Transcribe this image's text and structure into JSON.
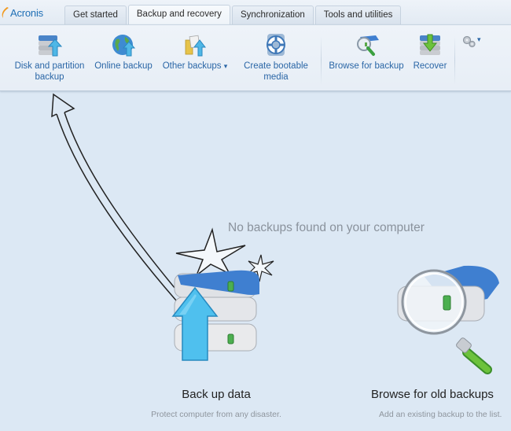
{
  "app": {
    "logo_text": "Acronis",
    "brand_color": "#1f6fb5",
    "link_color": "#2a66a6"
  },
  "tabs": [
    {
      "label": "Get started",
      "active": false
    },
    {
      "label": "Backup and recovery",
      "active": true
    },
    {
      "label": "Synchronization",
      "active": false
    },
    {
      "label": "Tools and utilities",
      "active": false
    }
  ],
  "toolbar": {
    "disk_backup": {
      "line1": "Disk and partition",
      "line2": "backup",
      "icon": "disk-upload-icon"
    },
    "online_backup": {
      "label": "Online backup",
      "icon": "globe-upload-icon"
    },
    "other_backups": {
      "label": "Other backups",
      "dropdown_glyph": "▾",
      "icon": "files-upload-icon"
    },
    "bootable_media": {
      "line1": "Create bootable",
      "line2": "media",
      "icon": "lifebuoy-icon"
    },
    "browse_backup": {
      "label": "Browse for backup",
      "icon": "magnifier-disk-icon"
    },
    "recover": {
      "label": "Recover",
      "icon": "disk-download-icon"
    },
    "settings": {
      "icon": "gears-icon",
      "dropdown_glyph": "▾"
    }
  },
  "main": {
    "empty_message": "No backups found on your computer",
    "actions": [
      {
        "title": "Back up data",
        "subtitle": "Protect computer from any disaster.",
        "icon": "disk-stack-upload-icon"
      },
      {
        "title": "Browse for old backups",
        "subtitle": "Add an existing backup to the list.",
        "icon": "magnifier-disk-icon"
      }
    ]
  }
}
